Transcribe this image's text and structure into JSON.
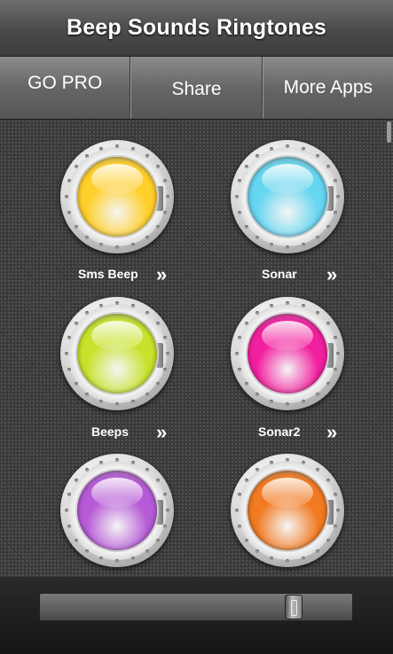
{
  "header": {
    "title": "Beep Sounds Ringtones"
  },
  "tabs": {
    "gopro": "GO PRO",
    "share": "Share",
    "more": "More Apps"
  },
  "sounds": [
    {
      "label": "Sms Beep",
      "color": "#ffcf2a",
      "chevron": "»"
    },
    {
      "label": "Sonar",
      "color": "#67d6f0",
      "chevron": "»"
    },
    {
      "label": "Beeps",
      "color": "#c8e22c",
      "chevron": "»"
    },
    {
      "label": "Sonar2",
      "color": "#f21f9e",
      "chevron": "»"
    },
    {
      "label": "",
      "color": "#b65ad6"
    },
    {
      "label": "",
      "color": "#f27a22"
    }
  ],
  "player": {
    "progress": 0.83
  }
}
